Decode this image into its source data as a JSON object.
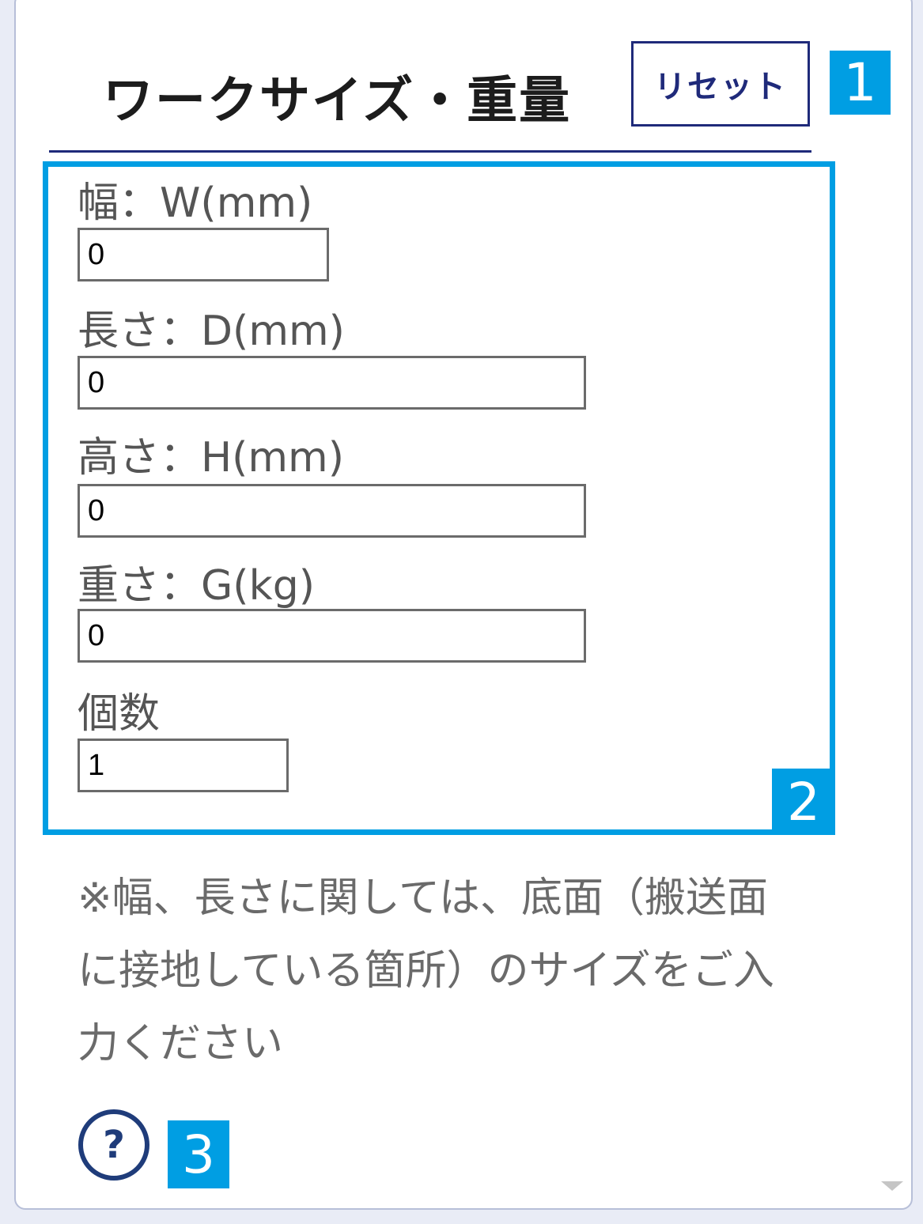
{
  "header": {
    "title": "ワークサイズ・重量",
    "reset_label": "リセット"
  },
  "badges": [
    "1",
    "2",
    "3"
  ],
  "fields": {
    "width": {
      "label": "幅：W(mm)",
      "value": "0"
    },
    "depth": {
      "label": "長さ：D(mm)",
      "value": "0"
    },
    "height": {
      "label": "高さ：H(mm)",
      "value": "0"
    },
    "weight": {
      "label": "重さ：G(kg)",
      "value": "0"
    },
    "quantity": {
      "label": "個数",
      "value": "1"
    }
  },
  "note": "※幅、長さに関しては、底面（搬送面に接地している箇所）のサイズをご入力ください",
  "colors": {
    "accent": "#1f2a7a",
    "highlight": "#009ee3"
  },
  "icons": {
    "help": "question-circle-icon"
  }
}
